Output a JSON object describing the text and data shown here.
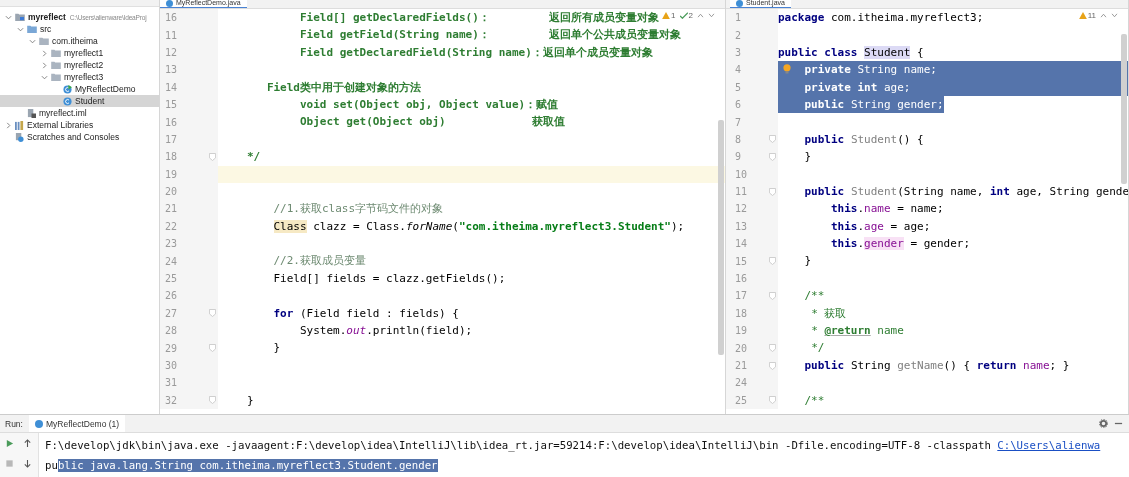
{
  "project": {
    "tree": [
      {
        "label": "myreflect",
        "kind": "module",
        "path": "C:\\Users\\alienware\\IdeaProj",
        "expanded": true,
        "selected": false,
        "children": [
          {
            "label": "src",
            "kind": "source",
            "expanded": true,
            "selected": false,
            "children": [
              {
                "label": "com.itheima",
                "kind": "package",
                "expanded": true,
                "selected": false,
                "children": [
                  {
                    "label": "myreflect1",
                    "kind": "package",
                    "expanded": false,
                    "selected": false
                  },
                  {
                    "label": "myreflect2",
                    "kind": "package",
                    "expanded": false,
                    "selected": false
                  },
                  {
                    "label": "myreflect3",
                    "kind": "package",
                    "expanded": true,
                    "selected": false,
                    "children": [
                      {
                        "label": "MyReflectDemo",
                        "kind": "main-class",
                        "selected": false
                      },
                      {
                        "label": "Student",
                        "kind": "class",
                        "selected": true
                      }
                    ]
                  }
                ]
              }
            ]
          },
          {
            "label": "myreflect.iml",
            "kind": "iml",
            "selected": false
          }
        ]
      },
      {
        "label": "External Libraries",
        "kind": "libraries",
        "expanded": false,
        "selected": false
      },
      {
        "label": "Scratches and Consoles",
        "kind": "scratches",
        "selected": false
      }
    ]
  },
  "editors": [
    {
      "tab": "MyReflectDemo.java",
      "inspections": [
        {
          "kind": "warning",
          "count": "1"
        },
        {
          "kind": "typo",
          "count": "2"
        }
      ],
      "lines": [
        {
          "number": "16",
          "tokens": [
            {
              "text": "        Field[] getDeclaredFields()：         返回所有成员变量对象",
              "kind": "doc"
            }
          ]
        },
        {
          "number": "11",
          "tokens": [
            {
              "text": "        Field getField(String name)：         返回单个公共成员变量对象",
              "kind": "doc"
            }
          ]
        },
        {
          "number": "12",
          "tokens": [
            {
              "text": "        Field getDeclaredField(String name)：返回单个成员变量对象",
              "kind": "doc"
            }
          ]
        },
        {
          "number": "13"
        },
        {
          "number": "14",
          "tokens": [
            {
              "text": "   Field类中用于创建对象的方法",
              "kind": "doc"
            }
          ]
        },
        {
          "number": "15",
          "tokens": [
            {
              "text": "        void set(Object obj, Object value)：赋值",
              "kind": "doc"
            }
          ]
        },
        {
          "number": "16",
          "tokens": [
            {
              "text": "        Object get(Object obj)             获取值",
              "kind": "doc"
            }
          ]
        },
        {
          "number": "17"
        },
        {
          "number": "18",
          "fold": true,
          "tokens": [
            {
              "text": "*/",
              "kind": "doc"
            }
          ]
        },
        {
          "number": "19",
          "current": true
        },
        {
          "number": "20"
        },
        {
          "number": "21",
          "tokens": [
            {
              "text": "    //1.获取class字节码文件的对象",
              "kind": "comment"
            }
          ]
        },
        {
          "number": "22",
          "tokens": [
            {
              "text": "    Class",
              "kind": "mark-usage"
            },
            {
              "text": " clazz = Class.",
              "kind": "plain"
            },
            {
              "text": "forName",
              "kind": "italic"
            },
            {
              "text": "(",
              "kind": "plain"
            },
            {
              "text": "\"com.itheima.myreflect3.Student\"",
              "kind": "string"
            },
            {
              "text": ");",
              "kind": "plain"
            }
          ]
        },
        {
          "number": "23"
        },
        {
          "number": "24",
          "tokens": [
            {
              "text": "    //2.获取成员变量",
              "kind": "comment"
            }
          ]
        },
        {
          "number": "25",
          "tokens": [
            {
              "text": "    Field[] fields = clazz.getFields();",
              "kind": "plain"
            }
          ]
        },
        {
          "number": "26"
        },
        {
          "number": "27",
          "fold": true,
          "tokens": [
            {
              "text": "    for",
              "kind": "kw"
            },
            {
              "text": " (Field field : fields) {",
              "kind": "plain"
            }
          ]
        },
        {
          "number": "28",
          "tokens": [
            {
              "text": "        System.",
              "kind": "plain"
            },
            {
              "text": "out",
              "kind": "static"
            },
            {
              "text": ".println(field);",
              "kind": "plain"
            }
          ]
        },
        {
          "number": "29",
          "fold": true,
          "tokens": [
            {
              "text": "    }",
              "kind": "plain"
            }
          ]
        },
        {
          "number": "30"
        },
        {
          "number": "31"
        },
        {
          "number": "32",
          "fold": true,
          "tokens": [
            {
              "text": "}",
              "kind": "plain"
            }
          ]
        }
      ]
    },
    {
      "tab": "Student.java",
      "inspections": [
        {
          "kind": "warning",
          "count": "11"
        }
      ],
      "lines": [
        {
          "number": "1",
          "tokens": [
            {
              "text": "package",
              "kind": "kw"
            },
            {
              "text": " com.itheima.myreflect3;",
              "kind": "plain"
            }
          ]
        },
        {
          "number": "2"
        },
        {
          "number": "3",
          "tokens": [
            {
              "text": "public class",
              "kind": "kw"
            },
            {
              "text": " Student",
              "kind": "mark-decl"
            },
            {
              "text": " {",
              "kind": "plain"
            }
          ]
        },
        {
          "number": "4",
          "current": true,
          "selected": true,
          "bulb": true,
          "tokens": [
            {
              "text": "    private",
              "kind": "kw"
            },
            {
              "text": " String",
              "kind": "plain"
            },
            {
              "text": " name",
              "kind": "field"
            },
            {
              "text": ";",
              "kind": "plain"
            }
          ]
        },
        {
          "number": "5",
          "selected": true,
          "tokens": [
            {
              "text": "    private int",
              "kind": "kw"
            },
            {
              "text": " age",
              "kind": "field"
            },
            {
              "text": ";",
              "kind": "plain"
            }
          ]
        },
        {
          "number": "6",
          "selected": true,
          "tokens": [
            {
              "text": "    public",
              "kind": "kw"
            },
            {
              "text": " String",
              "kind": "plain"
            },
            {
              "text": " gender",
              "kind": "field"
            },
            {
              "text": ";",
              "kind": "plain"
            }
          ]
        },
        {
          "number": "7"
        },
        {
          "number": "8",
          "fold": true,
          "tokens": [
            {
              "text": "    public",
              "kind": "kw"
            },
            {
              "text": " Student",
              "kind": "unused"
            },
            {
              "text": "() {",
              "kind": "plain"
            }
          ]
        },
        {
          "number": "9",
          "fold": true,
          "tokens": [
            {
              "text": "    }",
              "kind": "plain"
            }
          ]
        },
        {
          "number": "10"
        },
        {
          "number": "11",
          "fold": true,
          "tokens": [
            {
              "text": "    public",
              "kind": "kw"
            },
            {
              "text": " Student",
              "kind": "unused"
            },
            {
              "text": "(String name,",
              "kind": "plain"
            },
            {
              "text": " int",
              "kind": "kw"
            },
            {
              "text": " age, String gende",
              "kind": "plain"
            }
          ]
        },
        {
          "number": "12",
          "tokens": [
            {
              "text": "        this",
              "kind": "kw"
            },
            {
              "text": ".",
              "kind": "plain"
            },
            {
              "text": "name",
              "kind": "field"
            },
            {
              "text": " = name;",
              "kind": "plain"
            }
          ]
        },
        {
          "number": "13",
          "tokens": [
            {
              "text": "        this",
              "kind": "kw"
            },
            {
              "text": ".",
              "kind": "plain"
            },
            {
              "text": "age",
              "kind": "field"
            },
            {
              "text": " = age;",
              "kind": "plain"
            }
          ]
        },
        {
          "number": "14",
          "tokens": [
            {
              "text": "        this",
              "kind": "kw"
            },
            {
              "text": ".",
              "kind": "plain"
            },
            {
              "text": "gender",
              "kind": "mark-field"
            },
            {
              "text": " = gender;",
              "kind": "plain"
            }
          ]
        },
        {
          "number": "15",
          "fold": true,
          "tokens": [
            {
              "text": "    }",
              "kind": "plain"
            }
          ]
        },
        {
          "number": "16"
        },
        {
          "number": "17",
          "fold": true,
          "tokens": [
            {
              "text": "    /**",
              "kind": "javadoc"
            }
          ]
        },
        {
          "number": "18",
          "tokens": [
            {
              "text": "     * 获取",
              "kind": "javadoc"
            }
          ]
        },
        {
          "number": "19",
          "tokens": [
            {
              "text": "     *",
              "kind": "javadoc"
            },
            {
              "text": " @return",
              "kind": "doctag"
            },
            {
              "text": " name",
              "kind": "javadoc"
            }
          ]
        },
        {
          "number": "20",
          "fold": true,
          "tokens": [
            {
              "text": "     */",
              "kind": "javadoc"
            }
          ]
        },
        {
          "number": "21",
          "fold": true,
          "tokens": [
            {
              "text": "    public",
              "kind": "kw"
            },
            {
              "text": " String",
              "kind": "plain"
            },
            {
              "text": " getName",
              "kind": "unused"
            },
            {
              "text": "() {",
              "kind": "plain"
            },
            {
              "text": " return",
              "kind": "kw"
            },
            {
              "text": " name",
              "kind": "field"
            },
            {
              "text": "; }",
              "kind": "plain"
            }
          ]
        },
        {
          "number": "24"
        },
        {
          "number": "25",
          "fold": true,
          "tokens": [
            {
              "text": "    /**",
              "kind": "javadoc"
            }
          ]
        }
      ]
    }
  ],
  "run_panel": {
    "title": "Run:",
    "tab": "MyReflectDemo (1)",
    "output": [
      {
        "segments": [
          {
            "text": "F:\\develop\\jdk\\bin\\java.exe -javaagent:F:\\develop\\idea\\IntelliJ\\lib\\idea_rt.jar=59214:F:\\develop\\idea\\IntelliJ\\bin -Dfile.encoding=UTF-8 -classpath ",
            "kind": "plain"
          },
          {
            "text": "C:\\Users\\alienwa",
            "kind": "link"
          }
        ]
      },
      {
        "segments": [
          {
            "text": "pu",
            "kind": "plain"
          },
          {
            "text": "blic java.lang.String com.itheima.myreflect3.Student.gender",
            "kind": "selected"
          }
        ]
      }
    ]
  }
}
